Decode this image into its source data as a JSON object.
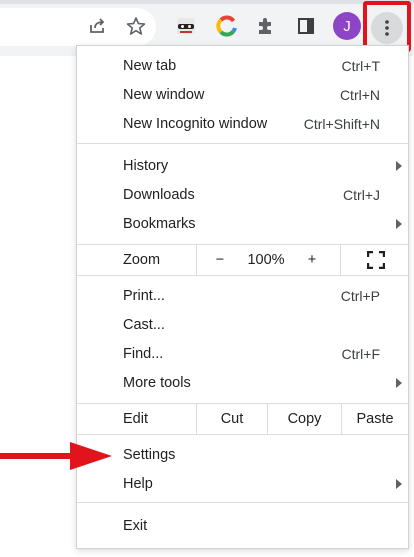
{
  "toolbar": {
    "share_icon": "share-icon",
    "star_icon": "bookmark-star-icon",
    "ext1_icon": "incognito-mask-extension-icon",
    "ext2_icon": "c-logo-extension-icon",
    "puzzle_icon": "extensions-puzzle-icon",
    "sidepanel_icon": "side-panel-icon",
    "avatar_letter": "J",
    "menu_icon": "three-dot-menu-icon"
  },
  "menu": {
    "group1": [
      {
        "label": "New tab",
        "shortcut": "Ctrl+T"
      },
      {
        "label": "New window",
        "shortcut": "Ctrl+N"
      },
      {
        "label": "New Incognito window",
        "shortcut": "Ctrl+Shift+N"
      }
    ],
    "group2": [
      {
        "label": "History",
        "shortcut": ""
      },
      {
        "label": "Downloads",
        "shortcut": "Ctrl+J"
      },
      {
        "label": "Bookmarks",
        "shortcut": ""
      }
    ],
    "zoom": {
      "label": "Zoom",
      "minus": "−",
      "value": "100%",
      "plus": "+"
    },
    "group3": [
      {
        "label": "Print...",
        "shortcut": "Ctrl+P"
      },
      {
        "label": "Cast...",
        "shortcut": ""
      },
      {
        "label": "Find...",
        "shortcut": "Ctrl+F"
      },
      {
        "label": "More tools",
        "shortcut": ""
      }
    ],
    "edit": {
      "label": "Edit",
      "cut": "Cut",
      "copy": "Copy",
      "paste": "Paste"
    },
    "group4": [
      {
        "label": "Settings",
        "shortcut": ""
      },
      {
        "label": "Help",
        "shortcut": ""
      }
    ],
    "exit": {
      "label": "Exit"
    }
  },
  "colors": {
    "highlight_red": "#e2141b",
    "avatar_purple": "#8e44c7",
    "toolbar_bg": "#f1f3f4"
  }
}
